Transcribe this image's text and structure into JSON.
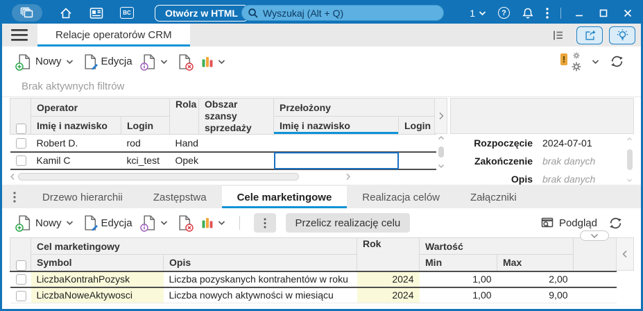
{
  "colors": {
    "accent": "#1273b8",
    "tab_underline": "#0e93d6",
    "focus_cell": "#1a6fc0",
    "cell_yellow": "#fafada"
  },
  "icons": {
    "bc_glyph": "BC",
    "help_glyph": "?",
    "warning_glyph": "!"
  },
  "topbar": {
    "open_html_label": "Otwórz w HTML",
    "search_placeholder": "Wyszukaj (Alt + Q)",
    "profile_count": "1"
  },
  "tabbar": {
    "active_tab": "Relacje operatorów CRM"
  },
  "top_toolbar": {
    "new_label": "Nowy",
    "edit_label": "Edycja"
  },
  "filter_bar": {
    "text": "Brak aktywnych filtrów"
  },
  "operators_table": {
    "group_headers": {
      "operator": "Operator",
      "rola": "Rola",
      "obszar": "Obszar szansy sprzedaży",
      "przelozony": "Przełożony"
    },
    "sub_headers": {
      "name": "Imię i nazwisko",
      "login": "Login",
      "sup_name": "Imię i nazwisko",
      "sup_login": "Login"
    },
    "rows": [
      {
        "name": "Robert D.",
        "login": "rod",
        "rola": "Hand",
        "obszar": "",
        "sup_name": "",
        "sup_login": ""
      },
      {
        "name": "Kamil C",
        "login": "kci_test",
        "rola": "Opek",
        "obszar": "",
        "sup_name": "",
        "sup_login": ""
      }
    ]
  },
  "details_panel": {
    "fields": [
      {
        "label": "Rozpoczęcie",
        "value": "2024-07-01"
      },
      {
        "label": "Zakończenie",
        "value": "brak danych"
      },
      {
        "label": "Opis",
        "value": "brak danych"
      }
    ]
  },
  "bottom_tabs": {
    "active_index": 2,
    "items": [
      {
        "label": "Drzewo hierarchii"
      },
      {
        "label": "Zastępstwa"
      },
      {
        "label": "Cele marketingowe"
      },
      {
        "label": "Realizacja celów"
      },
      {
        "label": "Załączniki"
      }
    ]
  },
  "bottom_toolbar": {
    "new_label": "Nowy",
    "edit_label": "Edycja",
    "recalc_label": "Przelicz realizację celu",
    "preview_label": "Podgląd"
  },
  "goals_table": {
    "group_headers": {
      "goal": "Cel marketingowy",
      "rok": "Rok",
      "wartosc": "Wartość"
    },
    "sub_headers": {
      "symbol": "Symbol",
      "opis": "Opis",
      "min": "Min",
      "max": "Max"
    },
    "rows": [
      {
        "symbol": "LiczbaKontrahPozysk",
        "opis": "Liczba pozyskanych kontrahentów w roku",
        "rok": "2024",
        "min": "1,00",
        "max": "2,00"
      },
      {
        "symbol": "LiczbaNoweAktywosci",
        "opis": "Liczba nowych aktywności w miesiącu",
        "rok": "2024",
        "min": "1,00",
        "max": "9,00"
      }
    ]
  }
}
